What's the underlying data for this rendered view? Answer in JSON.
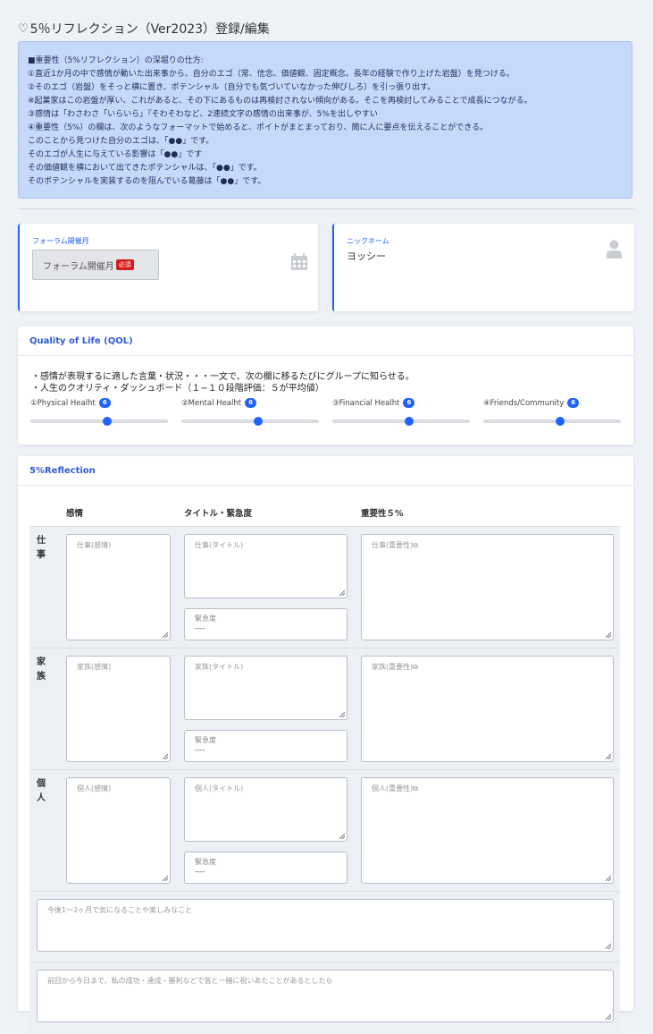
{
  "page": {
    "title": "5％リフレクション（Ver2023）登録/編集"
  },
  "info": {
    "lines": [
      "■重要性（5%リフレクション）の深堀りの仕方:",
      "①直近1か月の中で感情が動いた出来事から、自分のエゴ（常、信念、価値観、固定概念。長年の経験で作り上げた岩盤）を見つける。",
      "②そのエゴ（岩盤）をそっと横に置き、ポテンシャル（自分でも気づいていなかった伸びしろ）を引っ張り出す。",
      "※起業家はこの岩盤が厚い、これがあると、その下にあるものは再検討されない傾向がある。そこを再検討してみることで成長につながる。",
      "③感情は「わさわさ「いらいら」『そわそわなど、2速続文字の感情の出来事が、5%を出しやすい",
      "④重要性（5%）の欄は、次のようなフォーマットで始めると、ポイトがまとまっており、簡に人に要点を伝えることができる。",
      "このことから見つけた自分のエゴは、「●●」です。",
      "そのエゴが人生に与えている影響は「●●」です",
      "その価値観を横において出てきたポテンシャルは、「●●」です。",
      "そのポテンシャルを実装するのを阻んでいる葛藤は「●●」です。"
    ]
  },
  "forum": {
    "label": "フォーラム開催月",
    "select_value": "フォーラム開催月",
    "required_badge": "必須"
  },
  "nickname": {
    "label": "ニックネーム",
    "value": "ヨッシー"
  },
  "qol": {
    "title": "Quality of Life (QOL)",
    "desc1": "・感情が表現するに適した言葉・状況・・・一文で、次の欄に移るたびにグループに知らせる。",
    "desc2": "・人生のクオリティ・ダッシュボード（１−１０段階評価：５が平均値）",
    "sliders": [
      {
        "label": "①Physical Healht",
        "value": 6,
        "min": 1,
        "max": 10
      },
      {
        "label": "②Mental Healht",
        "value": 6,
        "min": 1,
        "max": 10
      },
      {
        "label": "③Financial Healht",
        "value": 6,
        "min": 1,
        "max": 10
      },
      {
        "label": "④Friends/Community",
        "value": 6,
        "min": 1,
        "max": 10
      }
    ]
  },
  "reflection": {
    "title": "5%Reflection",
    "col_emotion": "感情",
    "col_title": "タイトル・緊急度",
    "col_importance": "重要性５%",
    "urgency_label": "緊急度",
    "urgency_value": "----",
    "rows": [
      {
        "label": "仕事",
        "emotion_ph": "仕事(感情)",
        "title_ph": "仕事(タイトル)",
        "importance_ph": "仕事(重要性)"
      },
      {
        "label": "家族",
        "emotion_ph": "家族(感情)",
        "title_ph": "家族(タイトル)",
        "importance_ph": "家族(重要性)"
      },
      {
        "label": "個人",
        "emotion_ph": "個人(感情)",
        "title_ph": "個人(タイトル)",
        "importance_ph": "個人(重要性)"
      }
    ],
    "future_ph": "今後1〜2ヶ月で気になることや楽しみなこと",
    "celebrate_ph": "前回から今日まで、私の成功・達成・勝利などで皆と一緒に祝いあたことがあるとしたら"
  }
}
